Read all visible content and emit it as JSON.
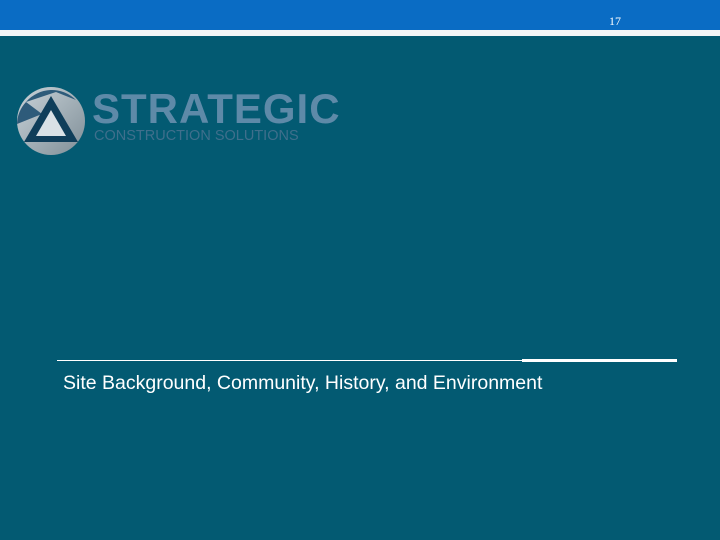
{
  "slide": {
    "page_number": "17",
    "subtitle": "Site Background, Community, History, and Environment"
  },
  "logo": {
    "wordmark": "STRATEGIC",
    "tagline": "CONSTRUCTION SOLUTIONS",
    "icon": "triangle-logo-icon"
  },
  "colors": {
    "background": "#035a72",
    "top_bar": "#0a6cc4",
    "text": "#ffffff",
    "logo_blue": "#5e8aa8"
  }
}
